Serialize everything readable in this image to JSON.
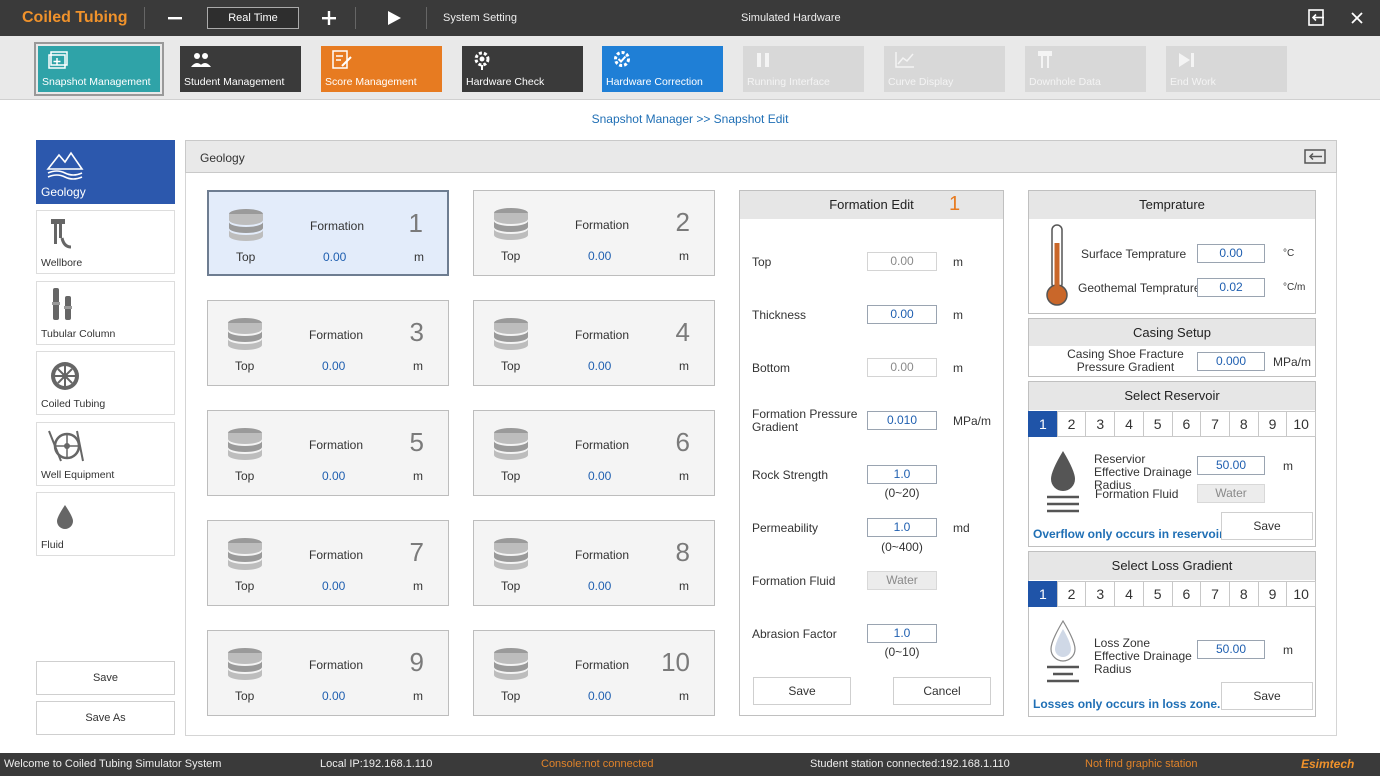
{
  "title_bar": {
    "app_title": "Coiled Tubing",
    "realtime_label": "Real Time",
    "system_setting": "System Setting",
    "hardware_mode": "Simulated Hardware"
  },
  "nav": [
    {
      "label": "Snapshot Management",
      "color": "#2fa3a8",
      "enabled": true
    },
    {
      "label": "Student Management",
      "color": "#3a3a3a",
      "enabled": true
    },
    {
      "label": "Score Management",
      "color": "#e77b21",
      "enabled": true
    },
    {
      "label": "Hardware Check",
      "color": "#3a3a3a",
      "enabled": true
    },
    {
      "label": "Hardware Correction",
      "color": "#1f7fd6",
      "enabled": true
    },
    {
      "label": "Running Interface",
      "color": "#d8d8d8",
      "enabled": false
    },
    {
      "label": "Curve Display",
      "color": "#d8d8d8",
      "enabled": false
    },
    {
      "label": "Downhole Data",
      "color": "#d8d8d8",
      "enabled": false
    },
    {
      "label": "End Work",
      "color": "#d8d8d8",
      "enabled": false
    }
  ],
  "breadcrumb": "Snapshot Manager >> Snapshot Edit",
  "sidebar": {
    "items": [
      {
        "label": "Geology",
        "icon": "mountain-icon"
      },
      {
        "label": "Wellbore",
        "icon": "wellbore-icon"
      },
      {
        "label": "Tubular Column",
        "icon": "tubular-icon"
      },
      {
        "label": "Coiled Tubing",
        "icon": "reel-icon"
      },
      {
        "label": "Well Equipment",
        "icon": "equipment-icon"
      },
      {
        "label": "Fluid",
        "icon": "droplet-icon"
      }
    ],
    "save": "Save",
    "save_as": "Save As"
  },
  "panel": {
    "title": "Geology"
  },
  "formations": {
    "name": "Formation",
    "top_label": "Top",
    "unit": "m",
    "items": [
      {
        "num": "1",
        "value": "0.00"
      },
      {
        "num": "2",
        "value": "0.00"
      },
      {
        "num": "3",
        "value": "0.00"
      },
      {
        "num": "4",
        "value": "0.00"
      },
      {
        "num": "5",
        "value": "0.00"
      },
      {
        "num": "6",
        "value": "0.00"
      },
      {
        "num": "7",
        "value": "0.00"
      },
      {
        "num": "8",
        "value": "0.00"
      },
      {
        "num": "9",
        "value": "0.00"
      },
      {
        "num": "10",
        "value": "0.00"
      }
    ]
  },
  "formation_edit": {
    "title": "Formation Edit",
    "current": "1",
    "top": {
      "label": "Top",
      "value": "0.00",
      "unit": "m"
    },
    "thickness": {
      "label": "Thickness",
      "value": "0.00",
      "unit": "m"
    },
    "bottom": {
      "label": "Bottom",
      "value": "0.00",
      "unit": "m"
    },
    "pressure": {
      "label": "Formation Pressure Gradient",
      "value": "0.010",
      "unit": "MPa/m"
    },
    "rock": {
      "label": "Rock Strength",
      "value": "1.0",
      "range": "(0~20)"
    },
    "perm": {
      "label": "Permeability",
      "value": "1.0",
      "range": "(0~400)",
      "unit": "md"
    },
    "fluid": {
      "label": "Formation Fluid",
      "value": "Water"
    },
    "abrasion": {
      "label": "Abrasion Factor",
      "value": "1.0",
      "range": "(0~10)"
    },
    "save": "Save",
    "cancel": "Cancel"
  },
  "temperature": {
    "title": "Temprature",
    "surface_label": "Surface Temprature",
    "surface_value": "0.00",
    "surface_unit": "°C",
    "geo_label": "Geothemal Temprature",
    "geo_value": "0.02",
    "geo_unit": "°C/m"
  },
  "casing": {
    "title": "Casing Setup",
    "label": "Casing Shoe Fracture Pressure Gradient",
    "value": "0.000",
    "unit": "MPa/m"
  },
  "reservoir": {
    "title": "Select Reservoir",
    "tabs": [
      "1",
      "2",
      "3",
      "4",
      "5",
      "6",
      "7",
      "8",
      "9",
      "10"
    ],
    "radius_label": "Reservior Effective Drainage Radius",
    "radius_value": "50.00",
    "radius_unit": "m",
    "fluid_label": "Formation Fluid",
    "fluid_value": "Water",
    "note": "Overflow only occurs in reservoir.",
    "save": "Save"
  },
  "loss": {
    "title": "Select Loss Gradient",
    "tabs": [
      "1",
      "2",
      "3",
      "4",
      "5",
      "6",
      "7",
      "8",
      "9",
      "10"
    ],
    "radius_label": "Loss Zone Effective Drainage Radius",
    "radius_value": "50.00",
    "radius_unit": "m",
    "note": "Losses only occurs in loss zone.",
    "save": "Save"
  },
  "status": {
    "welcome": "Welcome to Coiled Tubing Simulator System",
    "ip": "Local IP:192.168.1.110",
    "console": "Console:not connected",
    "station": "Student station connected:192.168.1.110",
    "graphic": "Not find graphic station",
    "brand": "Esimtech"
  }
}
